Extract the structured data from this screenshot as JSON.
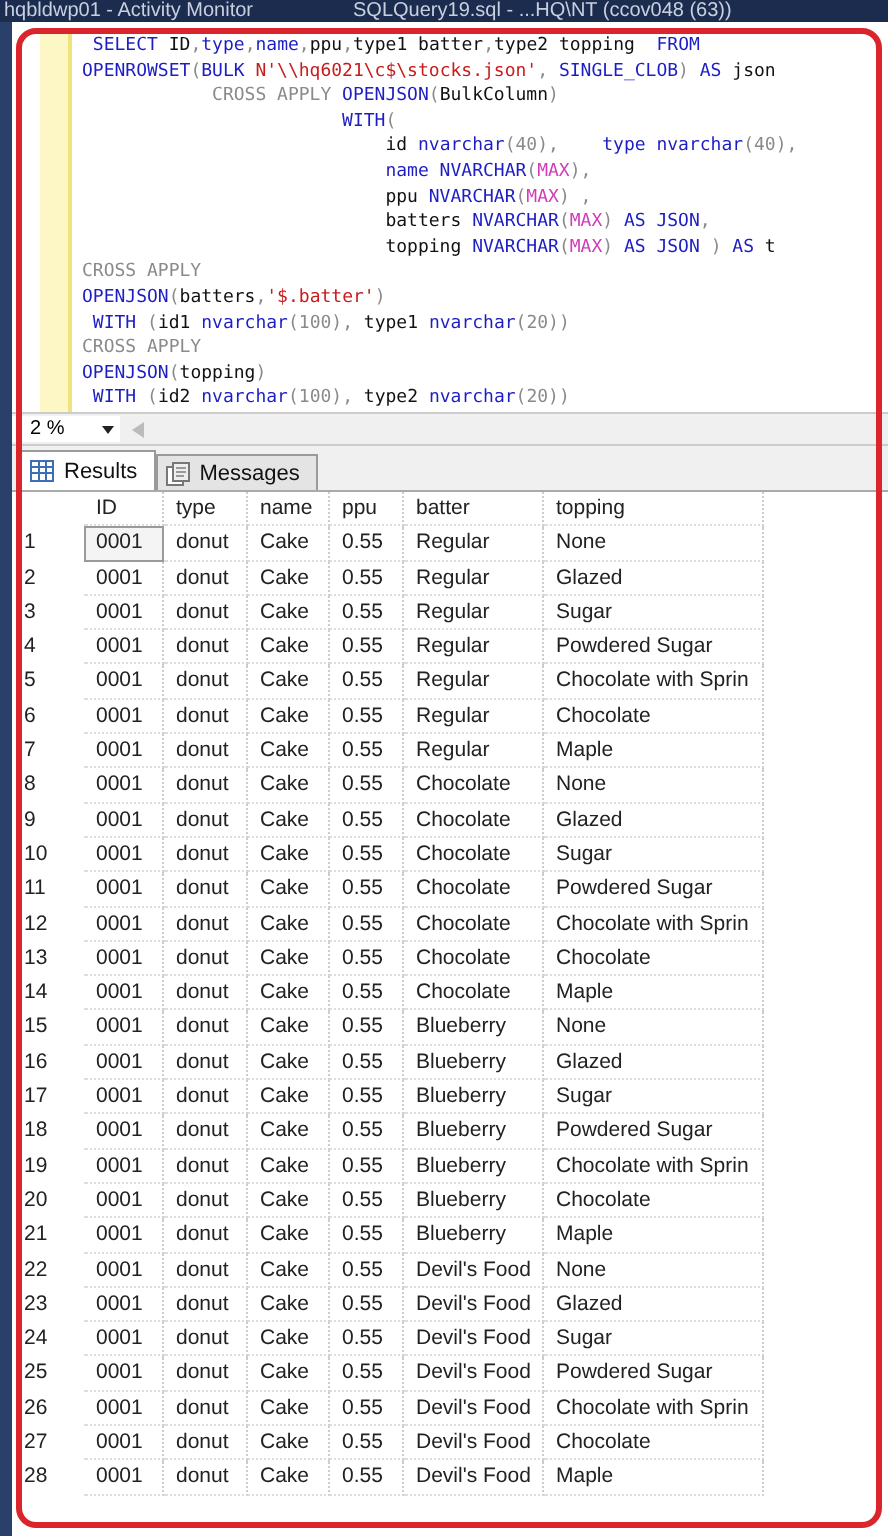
{
  "title_bar": {
    "tabs": [
      "hqbldwp01 - Activity Monitor",
      "SQLQuery19.sql - ...HQ\\NT (ccov048 (63))"
    ]
  },
  "editor": {
    "lines": [
      [
        {
          "kind": "keyword",
          "text": " SELECT"
        },
        {
          "kind": "plain",
          "text": " ID"
        },
        {
          "kind": "gray",
          "text": ","
        },
        {
          "kind": "keyword",
          "text": "type"
        },
        {
          "kind": "gray",
          "text": ","
        },
        {
          "kind": "keyword",
          "text": "name"
        },
        {
          "kind": "gray",
          "text": ","
        },
        {
          "kind": "plain",
          "text": "ppu"
        },
        {
          "kind": "gray",
          "text": ","
        },
        {
          "kind": "plain",
          "text": "type1 batter"
        },
        {
          "kind": "gray",
          "text": ","
        },
        {
          "kind": "plain",
          "text": "type2 topping  "
        },
        {
          "kind": "keyword",
          "text": "FROM"
        }
      ],
      [
        {
          "kind": "keyword",
          "text": "OPENROWSET"
        },
        {
          "kind": "gray",
          "text": "("
        },
        {
          "kind": "keyword",
          "text": "BULK "
        },
        {
          "kind": "string",
          "text": "N'\\\\hq6021\\c$\\stocks.json'"
        },
        {
          "kind": "gray",
          "text": ", "
        },
        {
          "kind": "keyword",
          "text": "SINGLE_CLOB"
        },
        {
          "kind": "gray",
          "text": ") "
        },
        {
          "kind": "keyword",
          "text": "AS"
        },
        {
          "kind": "plain",
          "text": " json"
        }
      ],
      [
        {
          "kind": "gray",
          "text": "            CROSS APPLY "
        },
        {
          "kind": "keyword",
          "text": "OPENJSON"
        },
        {
          "kind": "gray",
          "text": "("
        },
        {
          "kind": "plain",
          "text": "BulkColumn"
        },
        {
          "kind": "gray",
          "text": ")"
        }
      ],
      [
        {
          "kind": "keyword",
          "text": "                        WITH"
        },
        {
          "kind": "gray",
          "text": "("
        }
      ],
      [
        {
          "kind": "plain",
          "text": "                            id "
        },
        {
          "kind": "keyword",
          "text": "nvarchar"
        },
        {
          "kind": "gray",
          "text": "(40),    "
        },
        {
          "kind": "keyword",
          "text": "type nvarchar"
        },
        {
          "kind": "gray",
          "text": "(40),"
        }
      ],
      [
        {
          "kind": "keyword",
          "text": "                            name NVARCHAR"
        },
        {
          "kind": "gray",
          "text": "("
        },
        {
          "kind": "func",
          "text": "MAX"
        },
        {
          "kind": "gray",
          "text": "),"
        }
      ],
      [
        {
          "kind": "plain",
          "text": "                            ppu "
        },
        {
          "kind": "keyword",
          "text": "NVARCHAR"
        },
        {
          "kind": "gray",
          "text": "("
        },
        {
          "kind": "func",
          "text": "MAX"
        },
        {
          "kind": "gray",
          "text": ") ,"
        }
      ],
      [
        {
          "kind": "plain",
          "text": "                            batters "
        },
        {
          "kind": "keyword",
          "text": "NVARCHAR"
        },
        {
          "kind": "gray",
          "text": "("
        },
        {
          "kind": "func",
          "text": "MAX"
        },
        {
          "kind": "gray",
          "text": ") "
        },
        {
          "kind": "keyword",
          "text": "AS JSON"
        },
        {
          "kind": "gray",
          "text": ","
        }
      ],
      [
        {
          "kind": "plain",
          "text": "                            topping "
        },
        {
          "kind": "keyword",
          "text": "NVARCHAR"
        },
        {
          "kind": "gray",
          "text": "("
        },
        {
          "kind": "func",
          "text": "MAX"
        },
        {
          "kind": "gray",
          "text": ") "
        },
        {
          "kind": "keyword",
          "text": "AS JSON"
        },
        {
          "kind": "gray",
          "text": " ) "
        },
        {
          "kind": "keyword",
          "text": "AS"
        },
        {
          "kind": "plain",
          "text": " t"
        }
      ],
      [
        {
          "kind": "gray",
          "text": "CROSS APPLY"
        }
      ],
      [
        {
          "kind": "keyword",
          "text": "OPENJSON"
        },
        {
          "kind": "gray",
          "text": "("
        },
        {
          "kind": "plain",
          "text": "batters"
        },
        {
          "kind": "gray",
          "text": ","
        },
        {
          "kind": "string",
          "text": "'$.batter'"
        },
        {
          "kind": "gray",
          "text": ")"
        }
      ],
      [
        {
          "kind": "keyword",
          "text": " WITH"
        },
        {
          "kind": "gray",
          "text": " ("
        },
        {
          "kind": "plain",
          "text": "id1 "
        },
        {
          "kind": "keyword",
          "text": "nvarchar"
        },
        {
          "kind": "gray",
          "text": "(100), "
        },
        {
          "kind": "plain",
          "text": "type1 "
        },
        {
          "kind": "keyword",
          "text": "nvarchar"
        },
        {
          "kind": "gray",
          "text": "(20))"
        }
      ],
      [
        {
          "kind": "gray",
          "text": "CROSS APPLY"
        }
      ],
      [
        {
          "kind": "keyword",
          "text": "OPENJSON"
        },
        {
          "kind": "gray",
          "text": "("
        },
        {
          "kind": "plain",
          "text": "topping"
        },
        {
          "kind": "gray",
          "text": ")"
        }
      ],
      [
        {
          "kind": "keyword",
          "text": " WITH"
        },
        {
          "kind": "gray",
          "text": " ("
        },
        {
          "kind": "plain",
          "text": "id2 "
        },
        {
          "kind": "keyword",
          "text": "nvarchar"
        },
        {
          "kind": "gray",
          "text": "(100), "
        },
        {
          "kind": "plain",
          "text": "type2 "
        },
        {
          "kind": "keyword",
          "text": "nvarchar"
        },
        {
          "kind": "gray",
          "text": "(20))"
        }
      ]
    ]
  },
  "zoom": {
    "value": "2 %"
  },
  "tabs": [
    {
      "label": "Results",
      "selected": true
    },
    {
      "label": "Messages",
      "selected": false
    }
  ],
  "grid": {
    "columns": [
      "ID",
      "type",
      "name",
      "ppu",
      "batter",
      "topping"
    ],
    "rows": [
      {
        "num": "1",
        "selected": true,
        "cells": [
          "0001",
          "donut",
          "Cake",
          "0.55",
          "Regular",
          "None"
        ]
      },
      {
        "num": "2",
        "selected": false,
        "cells": [
          "0001",
          "donut",
          "Cake",
          "0.55",
          "Regular",
          "Glazed"
        ]
      },
      {
        "num": "3",
        "selected": false,
        "cells": [
          "0001",
          "donut",
          "Cake",
          "0.55",
          "Regular",
          "Sugar"
        ]
      },
      {
        "num": "4",
        "selected": false,
        "cells": [
          "0001",
          "donut",
          "Cake",
          "0.55",
          "Regular",
          "Powdered Sugar"
        ]
      },
      {
        "num": "5",
        "selected": false,
        "cells": [
          "0001",
          "donut",
          "Cake",
          "0.55",
          "Regular",
          "Chocolate with Sprin"
        ]
      },
      {
        "num": "6",
        "selected": false,
        "cells": [
          "0001",
          "donut",
          "Cake",
          "0.55",
          "Regular",
          "Chocolate"
        ]
      },
      {
        "num": "7",
        "selected": false,
        "cells": [
          "0001",
          "donut",
          "Cake",
          "0.55",
          "Regular",
          "Maple"
        ]
      },
      {
        "num": "8",
        "selected": false,
        "cells": [
          "0001",
          "donut",
          "Cake",
          "0.55",
          "Chocolate",
          "None"
        ]
      },
      {
        "num": "9",
        "selected": false,
        "cells": [
          "0001",
          "donut",
          "Cake",
          "0.55",
          "Chocolate",
          "Glazed"
        ]
      },
      {
        "num": "10",
        "selected": false,
        "cells": [
          "0001",
          "donut",
          "Cake",
          "0.55",
          "Chocolate",
          "Sugar"
        ]
      },
      {
        "num": "11",
        "selected": false,
        "cells": [
          "0001",
          "donut",
          "Cake",
          "0.55",
          "Chocolate",
          "Powdered Sugar"
        ]
      },
      {
        "num": "12",
        "selected": false,
        "cells": [
          "0001",
          "donut",
          "Cake",
          "0.55",
          "Chocolate",
          "Chocolate with Sprin"
        ]
      },
      {
        "num": "13",
        "selected": false,
        "cells": [
          "0001",
          "donut",
          "Cake",
          "0.55",
          "Chocolate",
          "Chocolate"
        ]
      },
      {
        "num": "14",
        "selected": false,
        "cells": [
          "0001",
          "donut",
          "Cake",
          "0.55",
          "Chocolate",
          "Maple"
        ]
      },
      {
        "num": "15",
        "selected": false,
        "cells": [
          "0001",
          "donut",
          "Cake",
          "0.55",
          "Blueberry",
          "None"
        ]
      },
      {
        "num": "16",
        "selected": false,
        "cells": [
          "0001",
          "donut",
          "Cake",
          "0.55",
          "Blueberry",
          "Glazed"
        ]
      },
      {
        "num": "17",
        "selected": false,
        "cells": [
          "0001",
          "donut",
          "Cake",
          "0.55",
          "Blueberry",
          "Sugar"
        ]
      },
      {
        "num": "18",
        "selected": false,
        "cells": [
          "0001",
          "donut",
          "Cake",
          "0.55",
          "Blueberry",
          "Powdered Sugar"
        ]
      },
      {
        "num": "19",
        "selected": false,
        "cells": [
          "0001",
          "donut",
          "Cake",
          "0.55",
          "Blueberry",
          "Chocolate with Sprin"
        ]
      },
      {
        "num": "20",
        "selected": false,
        "cells": [
          "0001",
          "donut",
          "Cake",
          "0.55",
          "Blueberry",
          "Chocolate"
        ]
      },
      {
        "num": "21",
        "selected": false,
        "cells": [
          "0001",
          "donut",
          "Cake",
          "0.55",
          "Blueberry",
          "Maple"
        ]
      },
      {
        "num": "22",
        "selected": false,
        "cells": [
          "0001",
          "donut",
          "Cake",
          "0.55",
          "Devil's Food",
          "None"
        ]
      },
      {
        "num": "23",
        "selected": false,
        "cells": [
          "0001",
          "donut",
          "Cake",
          "0.55",
          "Devil's Food",
          "Glazed"
        ]
      },
      {
        "num": "24",
        "selected": false,
        "cells": [
          "0001",
          "donut",
          "Cake",
          "0.55",
          "Devil's Food",
          "Sugar"
        ]
      },
      {
        "num": "25",
        "selected": false,
        "cells": [
          "0001",
          "donut",
          "Cake",
          "0.55",
          "Devil's Food",
          "Powdered Sugar"
        ]
      },
      {
        "num": "26",
        "selected": false,
        "cells": [
          "0001",
          "donut",
          "Cake",
          "0.55",
          "Devil's Food",
          "Chocolate with Sprin"
        ]
      },
      {
        "num": "27",
        "selected": false,
        "cells": [
          "0001",
          "donut",
          "Cake",
          "0.55",
          "Devil's Food",
          "Chocolate"
        ]
      },
      {
        "num": "28",
        "selected": false,
        "cells": [
          "0001",
          "donut",
          "Cake",
          "0.55",
          "Devil's Food",
          "Maple"
        ]
      }
    ]
  }
}
